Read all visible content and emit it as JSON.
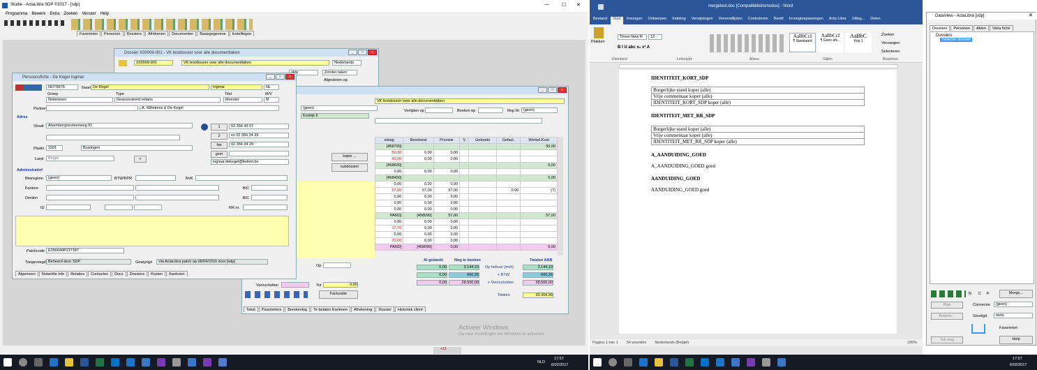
{
  "main_title": "Studie - ActaLibra  SDP ©2017 - [sdp]",
  "menu": [
    "Programma",
    "Bewerk",
    "Extra",
    "Zoeken",
    "Venster",
    "Help"
  ],
  "tabs_top": [
    "Favorieten",
    "Personen",
    "Dossiers",
    "Afrekenen",
    "Documenten",
    "Basisgegevens",
    "Instellingen"
  ],
  "dossier": {
    "title": "Dossier X00009-001 - VK testdossier voor alle documenttaken",
    "nr": "X00009-001",
    "desc": "VK testdossier voor alle documenttaken",
    "lang": "Nederlands",
    "akte": "akte",
    "taken": "Zonder taken",
    "afgesloten": "Afgesloten op",
    "geen": "(geen)",
    "kortrijk": "Kortrijk II",
    "verlijden": "Verlijden op",
    "boeken": "Boeken op",
    "rep": "Rep.Nr",
    "rep_val": "(geen)",
    "kopie": "kopie ...",
    "subdossier": "subdossier"
  },
  "grid": {
    "headers": [
      "edrag",
      "Berekend",
      "Provisie",
      "V",
      "Geboekt",
      "Gefact.",
      "Werkel.Kost"
    ],
    "rows": [
      [
        "[458790]",
        "",
        "",
        "",
        "",
        "",
        "50,00"
      ],
      [
        "50,00",
        "0,00",
        "0,00",
        "",
        "",
        "",
        ""
      ],
      [
        "50,00",
        "0,00",
        "0,00",
        "",
        "",
        "",
        ""
      ],
      [
        "[458600]",
        "",
        "",
        "",
        "",
        "",
        "0,00"
      ],
      [
        "0,00",
        "0,00",
        "0,00",
        "",
        "",
        "",
        ""
      ],
      [
        "[458400]",
        "",
        "",
        "",
        "",
        "",
        "0,00"
      ],
      [
        "0,00",
        "0,00",
        "0,00",
        "",
        "",
        "",
        ""
      ],
      [
        "57,00",
        "57,00",
        "57,00",
        "",
        "",
        "0.00",
        "(?)"
      ],
      [
        "0,00",
        "0,00",
        "0,00",
        "",
        "",
        "",
        ""
      ],
      [
        "0,00",
        "0,00",
        "0,00",
        "",
        "",
        "",
        ""
      ],
      [
        "0,00",
        "0,00",
        "0,00",
        "",
        "",
        "",
        ""
      ],
      [
        "PAND]",
        "[458099]",
        "57,00",
        "",
        "",
        "",
        "57,00"
      ],
      [
        "0,00",
        "0,00",
        "0,00",
        "",
        "",
        "",
        ""
      ],
      [
        "17,70",
        "0,00",
        "0,00",
        "",
        "",
        "",
        ""
      ],
      [
        "0,00",
        "0,00",
        "0,00",
        "",
        "",
        "",
        ""
      ],
      [
        "20,00",
        "0,00",
        "0,00",
        "",
        "",
        "",
        ""
      ],
      [
        "PAND]",
        "[458099]",
        "0,00",
        "",
        "",
        "",
        "0,00"
      ]
    ]
  },
  "totals": {
    "al_geboekt": "Al geboekt",
    "nog": "Nog te boeken",
    "totalen": "Totalen AKB",
    "r1": [
      "0,00",
      "3.144,10",
      "Op factuur (mvh)",
      "3.144,10"
    ],
    "r2": [
      "0,00",
      "660,26",
      "+ BTW",
      "660,26"
    ],
    "r3": [
      "0,00",
      "28.500,00",
      "+ Voorschotten",
      "28.500,00"
    ],
    "totaal_lbl": "Totalen",
    "totaal": "32.304,36",
    "op": "Op",
    "voorschotten": "Voorschotten",
    "tot": "Tot",
    "tot_val": "0,00",
    "facturatie": "Facturatie"
  },
  "dossier_tabs": [
    "Tekst",
    "Parameters",
    "Berekening",
    "Te betalen Erelonen",
    "Afrekening",
    "Dossier",
    "Historiek client"
  ],
  "person": {
    "title": "Persoonsfiche - De Kegel Ingmar",
    "id": "NOT8675",
    "naam_lbl": "Naam",
    "naam": "De Kegel",
    "voornaam": "Ingmar",
    "lang": "NL",
    "groep_lbl": "Groep",
    "groep": "Notarissen",
    "type_lbl": "Type",
    "type": "Geassocieerd notaris",
    "titel_lbl": "Titel",
    "titel": "Meester",
    "mv_lbl": "M/V",
    "mv": "M",
    "partner_lbl": "Partner",
    "partner": "A. Willekens & De Kegel",
    "adres": "Adres",
    "straat_lbl": "Straat",
    "straat": "Alsembergsesteenweg 91",
    "plaats_lbl": "Plaats",
    "postcode": "1501",
    "plaats": "Buizingen",
    "land_lbl": "Land",
    "land": "België",
    "tel1_lbl": "1",
    "tel1": "02 356 43 07",
    "tel2_lbl": "2",
    "tel2": "ex 02 356 34 29",
    "fax_lbl": "fax",
    "fax": "02 356 34 29",
    "gsm_lbl": "gsm",
    "mail": "ingmar.dekegel@belnot.be",
    "admin": "Administratief",
    "btw_lbl": "Btwregime",
    "btw": "(geen)",
    "btwnr_lbl": "BTW/KPR",
    "rvk_lbl": "RvK",
    "kantoor_lbl": "Kantoor",
    "derden_lbl": "Derden",
    "bic_lbl": "BIC",
    "id_lbl": "ID",
    "rrnr_lbl": "RR.nr.",
    "patch_lbl": "Patchcode",
    "patch": "E356640P217187",
    "toegevoegd_lbl": "Toegevoegd",
    "toegevoegd": "Beheerd door SDP",
    "gewijzigd_lbl": "Gewijzigd",
    "gewijzigd": "Via ActaLibra patch op 08/04/2016 door [sdp]",
    "tabs": [
      "Algemeen",
      "Notariële info",
      "Relaties",
      "Contacten",
      "Docs",
      "Dossiers",
      "Kosten",
      "Kantoren"
    ]
  },
  "watermark1": "Activeer Windows",
  "watermark2": "Ga naar Instellingen om Windows te activeren",
  "word": {
    "title": "mergetest.doc [Compatibiliteitsmodus] - Word",
    "tabs": [
      "Bestand",
      "Start",
      "Invoegen",
      "Ontwerpen",
      "Indeling",
      "Verwijzingen",
      "Verzendlijsten",
      "Controleren",
      "Beeld",
      "Invoegtoepassingen",
      "Acta Libra",
      "Uitleg...",
      "Delen"
    ],
    "font": "Times New R",
    "size": "12",
    "styles": [
      "AaBbCcI",
      "AaBbCcI",
      "AaBbC"
    ],
    "style_names": [
      "¶ Standaard",
      "¶ Geen afs...",
      "Kop 1"
    ],
    "groups": [
      "Klembord",
      "Lettertype",
      "Alinea",
      "Stijlen",
      "Bewerken"
    ],
    "plakken": "Plakken",
    "zoeken": "Zoeken",
    "vervangen": "Vervangen",
    "selecteren": "Selecteren",
    "h1": "IDENTITEIT_KORT_SDP",
    "t1": [
      "Burgerlijke stand koper (alle)",
      "Vrije commentaar koper (alle)",
      "IDENTITEIT_KORT_SDP koper (alle)"
    ],
    "h2": "IDENTITEIT_MET_RR_SDP",
    "t2": [
      "Burgerlijke stand koper (alle)",
      "Vrije commentaar koper (alle)",
      "IDENTITEIT_MET_RR_SDP koper (alle)"
    ],
    "h3": "A_AANDUIDING_GOED",
    "p3": "A_AANDUIDING_GOED goed",
    "h4": "AANDUIDING_GOED",
    "p4": "AANDUIDING_GOED goed",
    "status_page": "Pagina 1 van 1",
    "status_words": "54 woorden",
    "status_lang": "Nederlands (België)",
    "zoom": "100%"
  },
  "dataview": {
    "title": "DataView - ActaLibra [sdp]",
    "tabs": [
      "Dossiers",
      "Personen",
      "Akten",
      "Varia fiche"
    ],
    "tree_root": "Dossiers",
    "tree_sel": "Selectie dossier",
    "plak": "Plak",
    "bewerk": "Bewerk...",
    "conversie_lbl": "Conversie",
    "conversie": "(geen)",
    "gevolgd_lbl": "Gevolgd",
    "gevolgd": "niets",
    "favorieten": "Favorieten",
    "help": "Help",
    "merge": "Merge...",
    "tak": "Tak weg",
    "n": "N",
    "c": "C",
    "f": "F"
  },
  "tray": {
    "time": "17:57",
    "date": "6/02/2017",
    "lang": "NLD",
    "badge": "+11"
  },
  "tray2": {
    "time": "17:57",
    "date": "6/02/2017"
  }
}
